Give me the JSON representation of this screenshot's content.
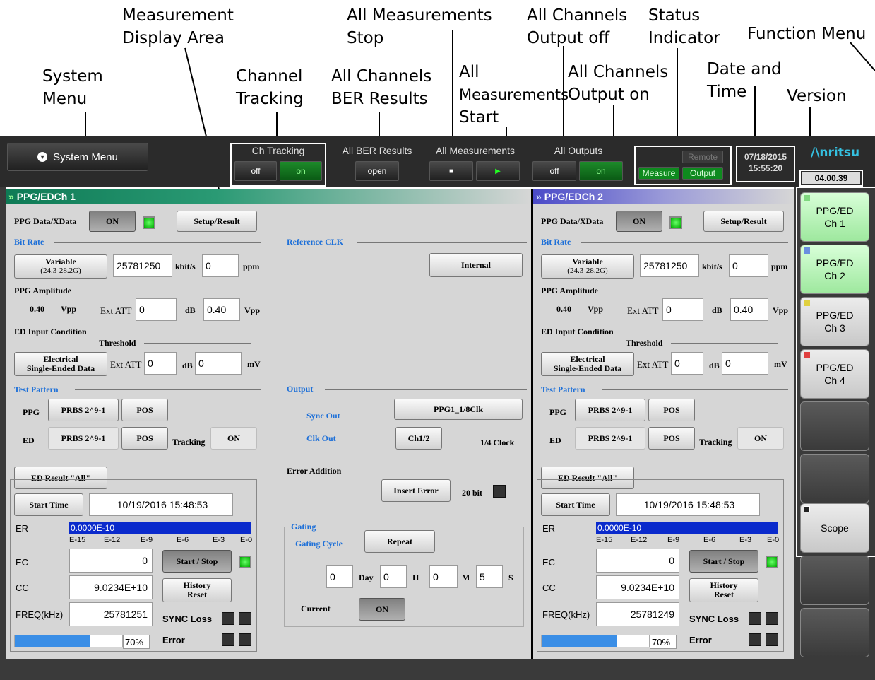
{
  "annotations": {
    "measurement_display_area": [
      "Measurement",
      "Display Area"
    ],
    "all_measurements_stop": [
      "All Measurements",
      "Stop"
    ],
    "all_channels_output_off": [
      "All Channels",
      "Output off"
    ],
    "status_indicator": [
      "Status",
      "Indicator"
    ],
    "function_menu": "Function Menu",
    "system_menu": [
      "System",
      "Menu"
    ],
    "channel_tracking": [
      "Channel",
      "Tracking"
    ],
    "all_channels_ber_results": [
      "All Channels",
      "BER Results"
    ],
    "all_measurements_start": [
      "All",
      "Measurements",
      "Start"
    ],
    "all_channels_output_on": [
      "All Channels",
      "Output on"
    ],
    "date_and_time": [
      "Date and",
      "Time"
    ],
    "version": "Version"
  },
  "topbar": {
    "system_menu": "System Menu",
    "ch_tracking": {
      "label": "Ch Tracking",
      "off": "off",
      "on": "on"
    },
    "all_ber_results": {
      "label": "All BER Results",
      "open": "open"
    },
    "all_measurements": {
      "label": "All Measurements",
      "stop": "■",
      "start": "▶"
    },
    "all_outputs": {
      "label": "All Outputs",
      "off": "off",
      "on": "on"
    },
    "status": {
      "remote": "Remote",
      "measure": "Measure",
      "output": "Output"
    },
    "date": "07/18/2015",
    "time": "15:55:20",
    "brand": "/\\nritsu",
    "version": "04.00.39"
  },
  "ch1": {
    "title": "PPG/EDCh 1",
    "ppg_data_label": "PPG Data/XData",
    "ppg_on": "ON",
    "setup_result": "Setup/Result",
    "bit_rate": "Bit Rate",
    "variable_btn": [
      "Variable",
      "(24.3-28.2G)"
    ],
    "bit_rate_value": "25781250",
    "kbits": "kbit/s",
    "ppm_value": "0",
    "ppm": "ppm",
    "ppg_amplitude": "PPG Amplitude",
    "amp_value": "0.40",
    "vpp": "Vpp",
    "ext_att": "Ext ATT",
    "ext_att_value": "0",
    "db": "dB",
    "amp_input": "0.40",
    "ed_input_condition": "ED Input Condition",
    "threshold": "Threshold",
    "electrical_btn": [
      "Electrical",
      "Single-Ended Data"
    ],
    "ed_ext_att_value": "0",
    "threshold_value": "0",
    "mv": "mV",
    "test_pattern": "Test Pattern",
    "ppg": "PPG",
    "ppg_pattern": "PRBS 2^9-1",
    "pos": "POS",
    "ed": "ED",
    "ed_pattern": "PRBS 2^9-1",
    "tracking": "Tracking",
    "tracking_value": "ON",
    "ed_result_all": "ED Result \"All\"",
    "start_time": "Start Time",
    "start_time_value": "10/19/2016 15:48:53",
    "er": "ER",
    "er_value": "0.0000E-10",
    "scale": [
      "E-15",
      "E-12",
      "E-9",
      "E-6",
      "E-3",
      "E-0"
    ],
    "ec": "EC",
    "ec_value": "0",
    "start_stop": "Start / Stop",
    "cc": "CC",
    "cc_value": "9.0234E+10",
    "history_reset": [
      "History",
      "Reset"
    ],
    "freq": "FREQ(kHz)",
    "freq_value": "25781251",
    "sync_loss": "SYNC Loss",
    "error": "Error",
    "progress_text": "70%",
    "progress": 0.7
  },
  "middle": {
    "reference_clk": "Reference CLK",
    "internal": "Internal",
    "output": "Output",
    "sync_out": "Sync Out",
    "sync_out_value": "PPG1_1/8Clk",
    "clk_out": "Clk Out",
    "clk_out_value": "Ch1/2",
    "quarter_clock": "1/4 Clock",
    "error_addition": "Error Addition",
    "insert_error": "Insert Error",
    "twenty_bit": "20  bit",
    "gating": "Gating",
    "gating_cycle": "Gating Cycle",
    "repeat": "Repeat",
    "day_value": "0",
    "day": "Day",
    "h_value": "0",
    "h": "H",
    "m_value": "0",
    "m": "M",
    "s_value": "5",
    "s": "S",
    "current": "Current",
    "current_value": "ON"
  },
  "ch2": {
    "title": "PPG/EDCh 2",
    "ppg_data_label": "PPG Data/XData",
    "ppg_on": "ON",
    "setup_result": "Setup/Result",
    "bit_rate": "Bit Rate",
    "variable_btn": [
      "Variable",
      "(24.3-28.2G)"
    ],
    "bit_rate_value": "25781250",
    "kbits": "kbit/s",
    "ppm_value": "0",
    "ppm": "ppm",
    "ppg_amplitude": "PPG Amplitude",
    "amp_value": "0.40",
    "vpp": "Vpp",
    "ext_att": "Ext ATT",
    "ext_att_value": "0",
    "db": "dB",
    "amp_input": "0.40",
    "ed_input_condition": "ED Input Condition",
    "threshold": "Threshold",
    "electrical_btn": [
      "Electrical",
      "Single-Ended Data"
    ],
    "ed_ext_att_value": "0",
    "threshold_value": "0",
    "mv": "mV",
    "test_pattern": "Test Pattern",
    "ppg": "PPG",
    "ppg_pattern": "PRBS 2^9-1",
    "pos": "POS",
    "ed": "ED",
    "ed_pattern": "PRBS 2^9-1",
    "tracking": "Tracking",
    "tracking_value": "ON",
    "ed_result_all": "ED Result \"All\"",
    "start_time": "Start Time",
    "start_time_value": "10/19/2016 15:48:53",
    "er": "ER",
    "er_value": "0.0000E-10",
    "scale": [
      "E-15",
      "E-12",
      "E-9",
      "E-6",
      "E-3",
      "E-0"
    ],
    "ec": "EC",
    "ec_value": "0",
    "start_stop": "Start / Stop",
    "cc": "CC",
    "cc_value": "9.0234E+10",
    "history_reset": [
      "History",
      "Reset"
    ],
    "freq": "FREQ(kHz)",
    "freq_value": "25781249",
    "sync_loss": "SYNC Loss",
    "error": "Error",
    "progress_text": "70%",
    "progress": 0.7
  },
  "function_menu": {
    "items": [
      {
        "label": [
          "PPG/ED",
          "Ch 1"
        ],
        "tag_color": "#7fd87f"
      },
      {
        "label": [
          "PPG/ED",
          "Ch 2"
        ],
        "tag_color": "#6a8ee0"
      },
      {
        "label": [
          "PPG/ED",
          "Ch 3"
        ],
        "tag_color": "#e0d040"
      },
      {
        "label": [
          "PPG/ED",
          "Ch 4"
        ],
        "tag_color": "#e04040"
      },
      {
        "label": [
          "Scope"
        ],
        "tag_color": "#ffffff"
      }
    ]
  },
  "colors": {
    "ch1_title": "#0e7a55",
    "ch2_title": "#5050c0",
    "accent_blue": "#1e70d8"
  }
}
